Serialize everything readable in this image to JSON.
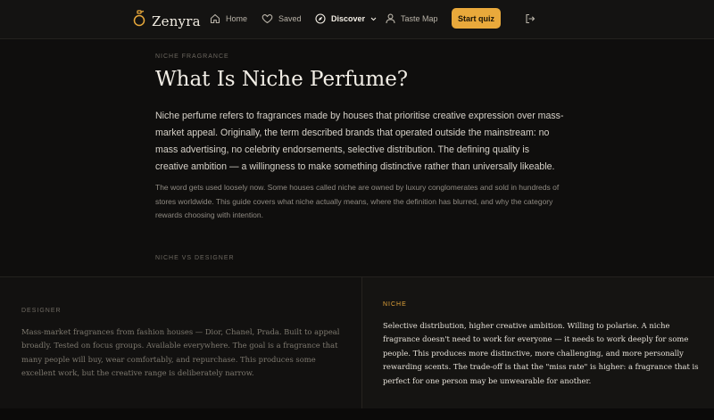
{
  "nav": {
    "brand": "Zenyra",
    "items": [
      {
        "label": "Home",
        "icon": "home-icon"
      },
      {
        "label": "Saved",
        "icon": "heart-icon"
      },
      {
        "label": "Discover",
        "icon": "compass-icon"
      },
      {
        "label": "Taste Map",
        "icon": "user-icon"
      }
    ],
    "cta": "Start quiz",
    "accent": "#e9a93b"
  },
  "article": {
    "eyebrow": "NICHE FRAGRANCE",
    "title": "What Is Niche Perfume?",
    "lead": "Niche perfume refers to fragrances made by houses that prioritise creative expression over mass-market appeal. Originally, the term described brands that operated outside the mainstream: no mass advertising, no celebrity endorsements, selective distribution. The defining quality is creative ambition — a willingness to make something distinctive rather than universally likeable.",
    "body": "The word gets used loosely now. Some houses called niche are owned by luxury conglomerates and sold in hundreds of stores worldwide. This guide covers what niche actually means, where the definition has blurred, and why the category rewards choosing with intention.",
    "section_label": "NICHE VS DESIGNER"
  },
  "compare": {
    "designer": {
      "label": "DESIGNER",
      "text": "Mass-market fragrances from fashion houses — Dior, Chanel, Prada. Built to appeal broadly. Tested on focus groups. Available everywhere. The goal is a fragrance that many people will buy, wear comfortably, and repurchase. This produces some excellent work, but the creative range is deliberately narrow."
    },
    "niche": {
      "label": "NICHE",
      "text": "Selective distribution, higher creative ambition. Willing to polarise. A niche fragrance doesn't need to work for everyone — it needs to work deeply for some people. This produces more distinctive, more challenging, and more personally rewarding scents. The trade-off is that the \"miss rate\" is higher: a fragrance that is perfect for one person may be unwearable for another."
    }
  }
}
